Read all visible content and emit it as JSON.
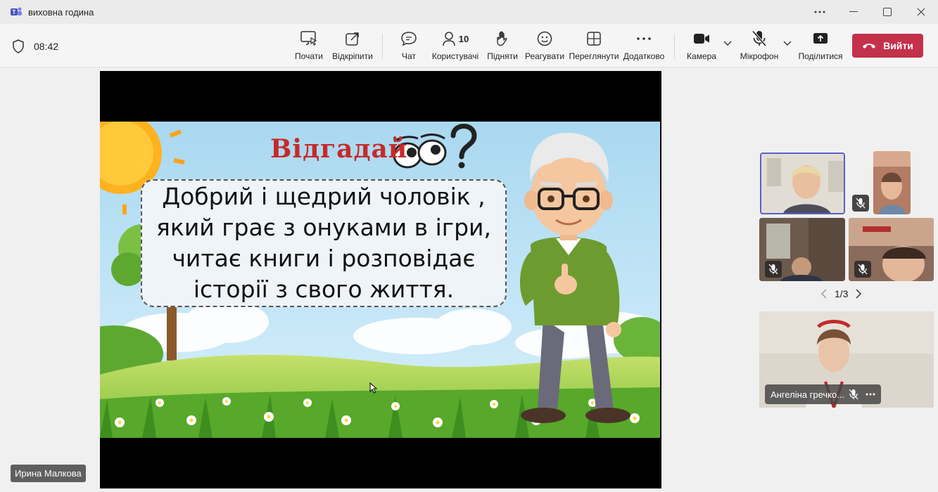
{
  "window": {
    "title": "виховна година"
  },
  "meeting": {
    "timer": "08:42"
  },
  "toolbar": {
    "start_label": "Почати",
    "popout_label": "Відкріпити",
    "chat_label": "Чат",
    "people_label": "Користувачі",
    "people_count": "10",
    "raise_label": "Підняти",
    "react_label": "Реагувати",
    "view_label": "Переглянути",
    "more_label": "Додатково",
    "camera_label": "Камера",
    "mic_label": "Мікрофон",
    "share_label": "Поділитися",
    "leave_label": "Вийти"
  },
  "slide": {
    "heading": "Відгадай",
    "riddle": "Добрий і щедрий чоловік , який грає з онуками в ігри, читає книги і розповідає історії з свого життя."
  },
  "presenter": {
    "name": "Ирина Малкова"
  },
  "gallery": {
    "page": "1/3",
    "spotlight_name": "Ангеліна гречко..."
  },
  "colors": {
    "leave": "#c4314b",
    "active_speaker": "#5b5fc7",
    "accent": "#5b5fc7"
  }
}
